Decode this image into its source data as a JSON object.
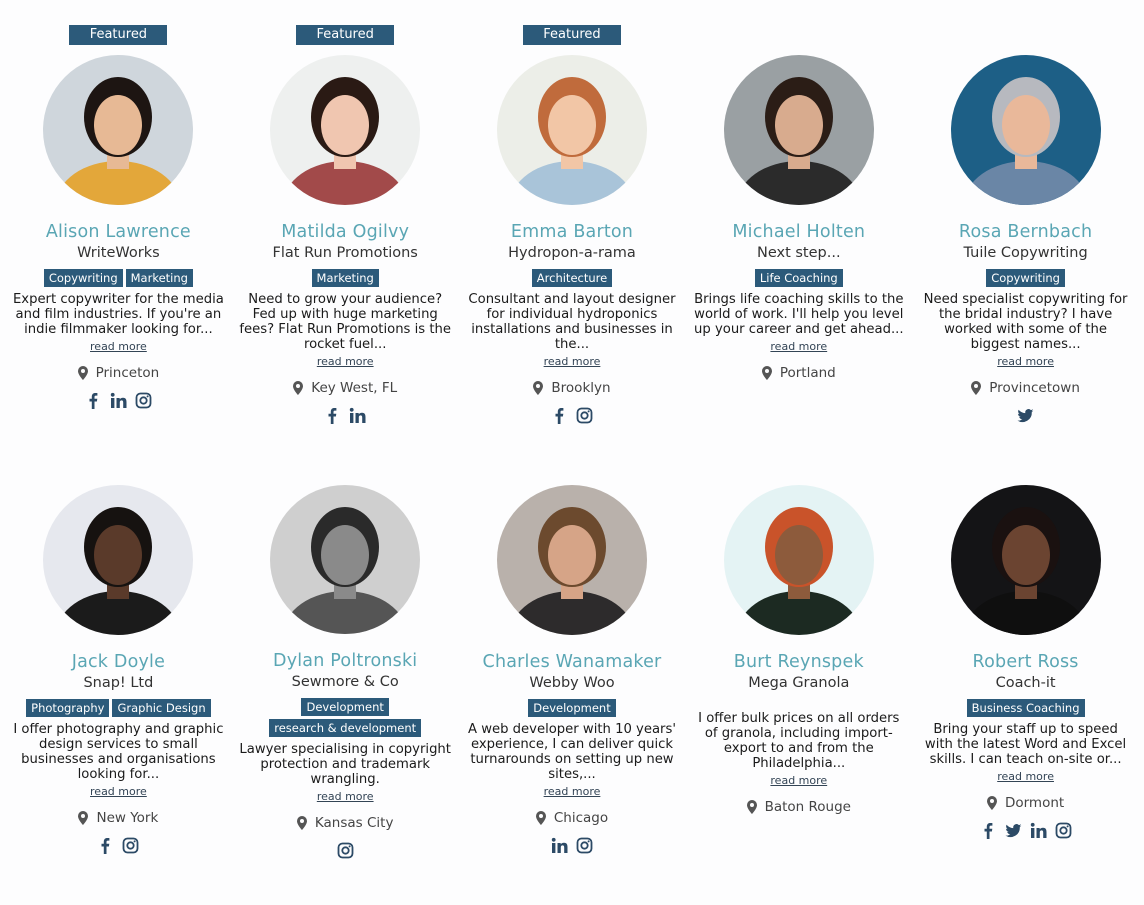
{
  "read_more_label": "read more",
  "featured_label": "Featured",
  "colors": {
    "accent": "#2c5a7a",
    "name": "#5aa6b4"
  },
  "profiles": [
    {
      "featured": true,
      "name": "Alison Lawrence",
      "company": "WriteWorks",
      "tags": [
        "Copywriting",
        "Marketing"
      ],
      "description": "Expert copywriter for the media and film industries. If you're an indie filmmaker looking for...",
      "location": "Princeton",
      "socials": [
        "facebook-icon",
        "linkedin-icon",
        "instagram-icon"
      ]
    },
    {
      "featured": true,
      "name": "Matilda Ogilvy",
      "company": "Flat Run Promotions",
      "tags": [
        "Marketing"
      ],
      "description": "Need to grow your audience? Fed up with huge marketing fees? Flat Run Promotions is the rocket fuel...",
      "location": "Key West, FL",
      "socials": [
        "facebook-icon",
        "linkedin-icon"
      ]
    },
    {
      "featured": true,
      "name": "Emma Barton",
      "company": "Hydropon-a-rama",
      "tags": [
        "Architecture"
      ],
      "description": "Consultant and layout designer for individual hydroponics installations and businesses in the...",
      "location": "Brooklyn",
      "socials": [
        "facebook-icon",
        "instagram-icon"
      ]
    },
    {
      "featured": false,
      "name": "Michael Holten",
      "company": "Next step...",
      "tags": [
        "Life Coaching"
      ],
      "description": "Brings life coaching skills to the world of work. I'll help you level up your career and get ahead...",
      "location": "Portland",
      "socials": []
    },
    {
      "featured": false,
      "name": "Rosa Bernbach",
      "company": "Tuile Copywriting",
      "tags": [
        "Copywriting"
      ],
      "description": "Need specialist copywriting for the bridal industry? I have worked with some of the biggest names...",
      "location": "Provincetown",
      "socials": [
        "twitter-icon"
      ]
    },
    {
      "featured": false,
      "name": "Jack Doyle",
      "company": "Snap! Ltd",
      "tags": [
        "Photography",
        "Graphic Design"
      ],
      "description": "I offer photography and graphic design services to small businesses and organisations looking for...",
      "location": "New York",
      "socials": [
        "facebook-icon",
        "instagram-icon"
      ]
    },
    {
      "featured": false,
      "name": "Dylan Poltronski",
      "company": "Sewmore & Co",
      "tags": [
        "Development",
        "research & development"
      ],
      "description": "Lawyer specialising in copyright protection and trademark wrangling.",
      "location": "Kansas City",
      "socials": [
        "instagram-icon"
      ]
    },
    {
      "featured": false,
      "name": "Charles Wanamaker",
      "company": "Webby Woo",
      "tags": [
        "Development"
      ],
      "description": "A web developer with 10 years' experience, I can deliver quick turnarounds on setting up new sites,...",
      "location": "Chicago",
      "socials": [
        "linkedin-icon",
        "instagram-icon"
      ]
    },
    {
      "featured": false,
      "name": "Burt Reynspek",
      "company": "Mega Granola",
      "tags": [],
      "description": "I offer bulk prices on all orders of granola, including import-export to and from the Philadelphia...",
      "location": "Baton Rouge",
      "socials": []
    },
    {
      "featured": false,
      "name": "Robert Ross",
      "company": "Coach-it",
      "tags": [
        "Business Coaching"
      ],
      "description": "Bring your staff up to speed with the latest Word and Excel skills. I can teach on-site or...",
      "location": "Dormont",
      "socials": [
        "facebook-icon",
        "twitter-icon",
        "linkedin-icon",
        "instagram-icon"
      ]
    }
  ]
}
